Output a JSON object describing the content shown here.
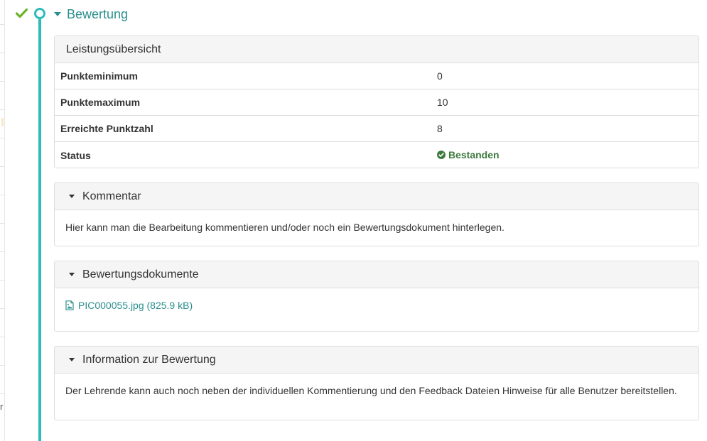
{
  "section": {
    "title": "Bewertung",
    "step_status_icon": "check-icon",
    "accent_color": "#2ebcb9",
    "title_color": "#2a8f8d"
  },
  "overview": {
    "title": "Leistungsübersicht",
    "rows": [
      {
        "label": "Punkteminimum",
        "value": "0"
      },
      {
        "label": "Punktemaximum",
        "value": "10"
      },
      {
        "label": "Erreichte Punktzahl",
        "value": "8"
      },
      {
        "label": "Status",
        "value": "Bestanden"
      }
    ],
    "status_color": "#3d7a3d"
  },
  "comment": {
    "title": "Kommentar",
    "text": "Hier kann man die Bearbeitung kommentieren und/oder noch ein Bewertungsdokument hinterlegen."
  },
  "documents": {
    "title": "Bewertungsdokumente",
    "files": [
      {
        "name": "PIC000055.jpg (825.9 kB)",
        "icon": "image-file-icon"
      }
    ]
  },
  "info": {
    "title": "Information zur Bewertung",
    "text": "Der Lehrende kann auch noch neben der individuellen Kommentierung und den Feedback Dateien Hinweise für alle Benutzer bereitstellen."
  },
  "left_edge_fragment": "r"
}
